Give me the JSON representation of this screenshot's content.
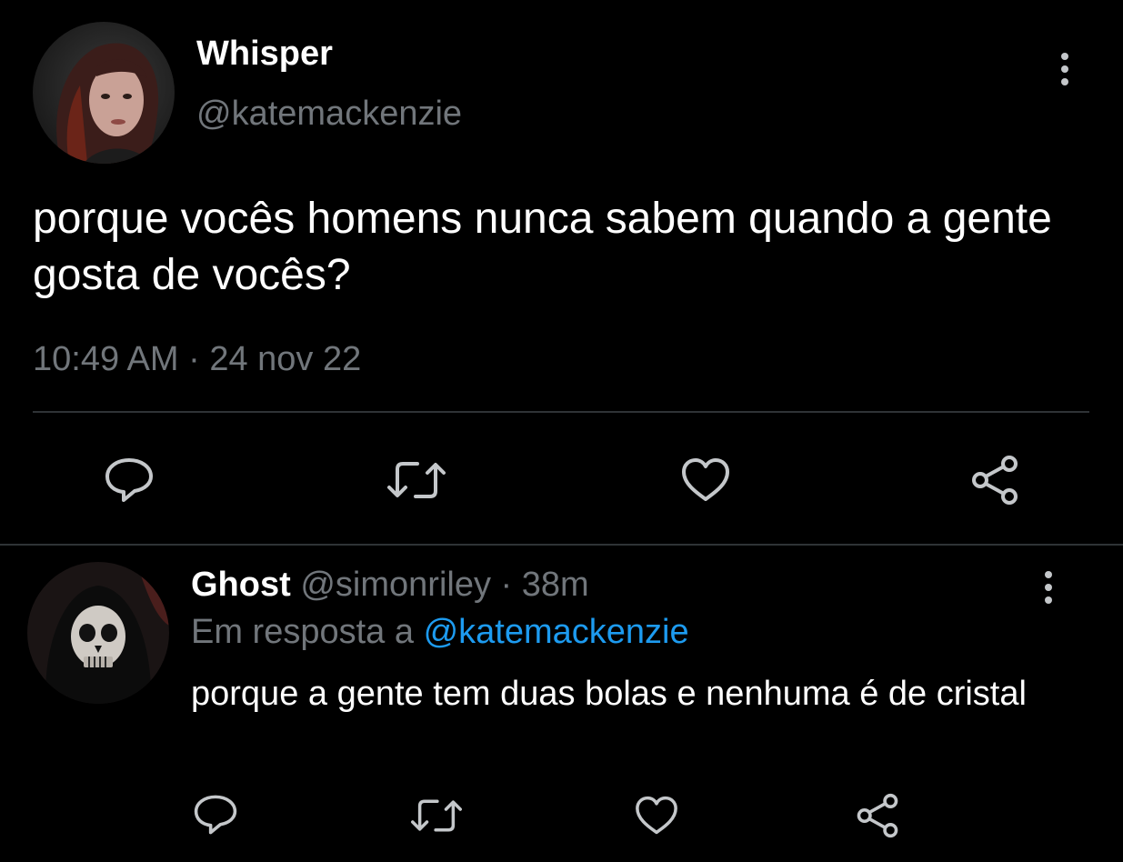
{
  "main_tweet": {
    "display_name": "Whisper",
    "handle": "@katemackenzie",
    "text": "porque vocês homens nunca sabem quando a gente gosta de vocês?",
    "time": "10:49 AM",
    "separator": "·",
    "date": "24 nov 22",
    "avatar_icon": "profile-photo-woman",
    "actions": [
      "reply-icon",
      "retweet-icon",
      "like-icon",
      "share-icon"
    ]
  },
  "reply_tweet": {
    "display_name": "Ghost",
    "handle": "@simonriley",
    "separator": "·",
    "age": "38m",
    "reply_prefix": "Em resposta a",
    "reply_to": "@katemackenzie",
    "text": "porque a gente tem duas bolas e nenhuma é de cristal",
    "avatar_icon": "profile-photo-skull-mask",
    "actions": [
      "reply-icon",
      "retweet-icon",
      "like-icon",
      "share-icon"
    ]
  },
  "colors": {
    "background": "#000000",
    "primary_text": "#ffffff",
    "secondary_text": "#71767b",
    "link": "#1d9bf0",
    "divider": "#2f3336",
    "icon": "#c4c7ca"
  }
}
